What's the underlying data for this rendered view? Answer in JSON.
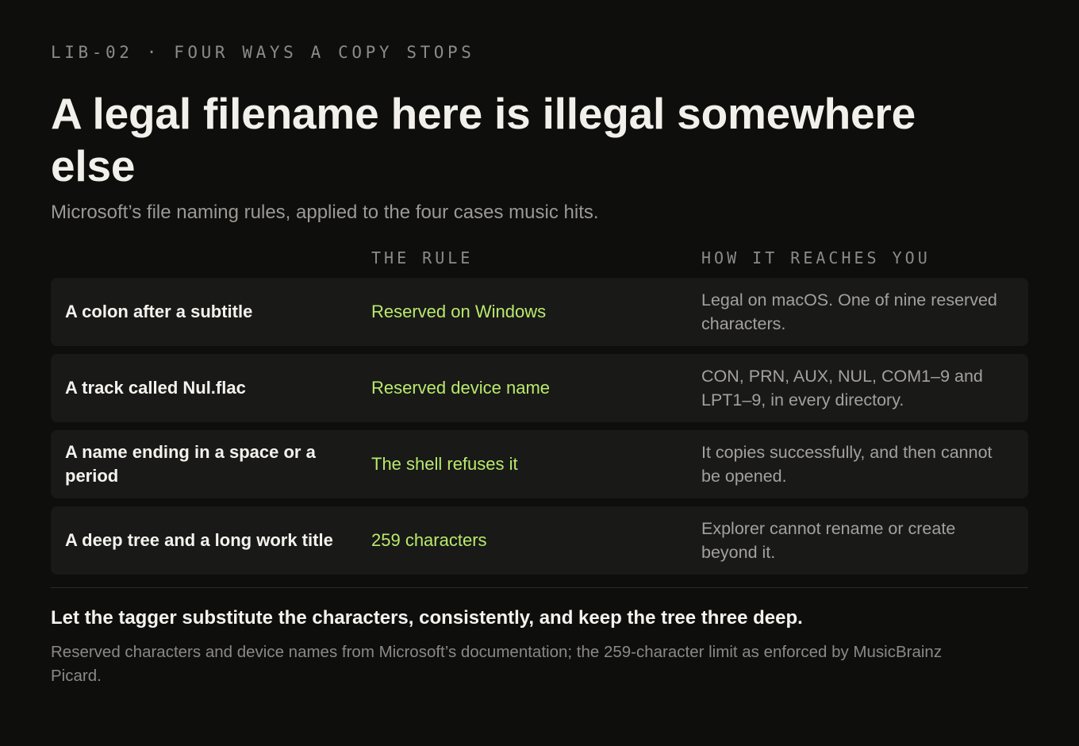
{
  "eyebrow": "LIB-02 · FOUR WAYS A COPY STOPS",
  "title": "A legal filename here is illegal somewhere else",
  "subtitle": "Microsoft’s file naming rules, applied to the four cases music hits.",
  "columns": {
    "rule": "THE RULE",
    "reach": "HOW IT REACHES YOU"
  },
  "rows": [
    {
      "case": "A colon after a subtitle",
      "rule": "Reserved on Windows",
      "reach": "Legal on macOS. One of nine reserved characters."
    },
    {
      "case": "A track called Nul.flac",
      "rule": "Reserved device name",
      "reach": "CON, PRN, AUX, NUL, COM1–9 and LPT1–9, in every directory."
    },
    {
      "case": "A name ending in a space or a period",
      "rule": "The shell refuses it",
      "reach": "It copies successfully, and then cannot be opened."
    },
    {
      "case": "A deep tree and a long work title",
      "rule": "259 characters",
      "reach": "Explorer cannot rename or create beyond it."
    }
  ],
  "takeaway": "Let the tagger substitute the characters, consistently, and keep the tree three deep.",
  "source": "Reserved characters and device names from Microsoft’s documentation; the 259-character limit as enforced by MusicBrainz Picard.",
  "colors": {
    "background": "#0e0e0d",
    "row_background": "#191918",
    "accent_green": "#b9ea6c",
    "muted_text": "#8d8b86"
  }
}
